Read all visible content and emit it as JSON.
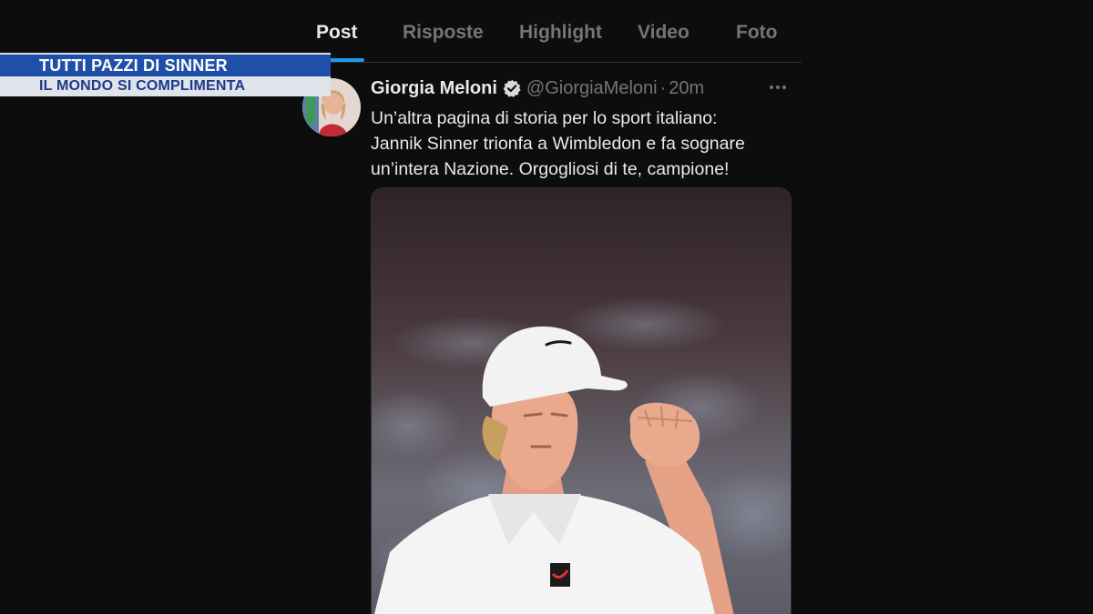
{
  "tabs": [
    {
      "label": "Post",
      "active": true
    },
    {
      "label": "Risposte",
      "active": false
    },
    {
      "label": "Highlight",
      "active": false
    },
    {
      "label": "Video",
      "active": false
    },
    {
      "label": "Foto",
      "active": false
    }
  ],
  "banner": {
    "line1": "TUTTI PAZZI DI SINNER",
    "line2": "IL MONDO SI COMPLIMENTA"
  },
  "tweet": {
    "author_name": "Giorgia Meloni",
    "verified_icon": "verified-badge-icon",
    "handle": "@GiorgiaMeloni",
    "separator": "·",
    "time": "20m",
    "more_icon": "more-options-icon",
    "text_lines": [
      "Un’altra pagina di storia per lo sport italiano:",
      "Jannik Sinner trionfa a Wimbledon e fa sognare",
      "un’intera Nazione. Orgogliosi di te, campione!"
    ]
  },
  "colors": {
    "background": "#0d0d0d",
    "accent": "#1d9bf0",
    "banner_blue": "#1f4fa8",
    "banner_light": "#dfe3ea",
    "text_primary": "#e7e9ea",
    "text_secondary": "#71767b"
  }
}
